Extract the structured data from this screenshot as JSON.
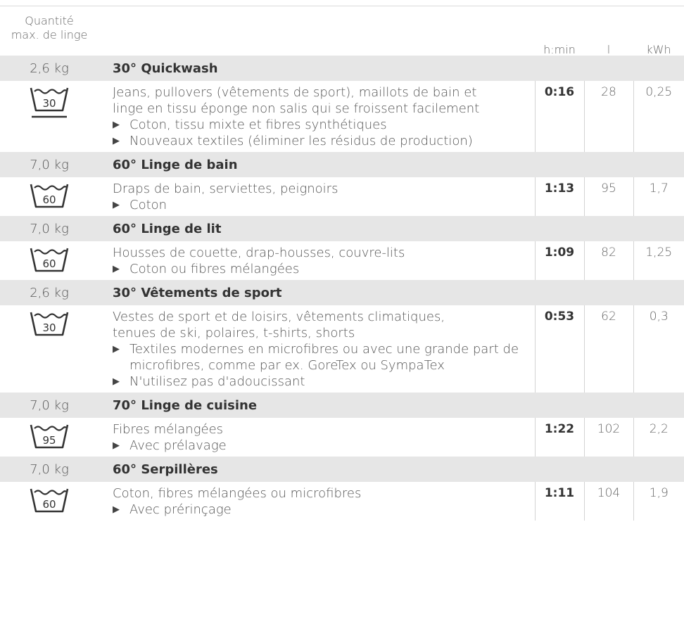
{
  "header": {
    "load_line1": "Quantité",
    "load_line2": "max. de linge",
    "time": "h:min",
    "water": "l",
    "energy": "kWh"
  },
  "programs": [
    {
      "load": "2,6 kg",
      "title": "30° Quickwash",
      "symbol_temp": "30",
      "symbol_underline": true,
      "desc_lines": [
        "Jeans, pullovers (vêtements de sport), maillots de bain et",
        "linge en tissu éponge non salis qui se froissent facilement"
      ],
      "bullets": [
        "Coton, tissu mixte et fibres synthétiques",
        "Nouveaux textiles (éliminer les résidus de production)"
      ],
      "time": "0:16",
      "water": "28",
      "energy": "0,25"
    },
    {
      "load": "7,0 kg",
      "title": "60° Linge de bain",
      "symbol_temp": "60",
      "symbol_underline": false,
      "desc_lines": [
        "Draps de bain, serviettes, peignoirs"
      ],
      "bullets": [
        "Coton"
      ],
      "time": "1:13",
      "water": "95",
      "energy": "1,7"
    },
    {
      "load": "7,0 kg",
      "title": "60° Linge de lit",
      "symbol_temp": "60",
      "symbol_underline": false,
      "desc_lines": [
        "Housses de couette, drap-housses, couvre-lits"
      ],
      "bullets": [
        "Coton ou fibres mélangées"
      ],
      "time": "1:09",
      "water": "82",
      "energy": "1,25"
    },
    {
      "load": "2,6 kg",
      "title": "30° Vêtements de sport",
      "symbol_temp": "30",
      "symbol_underline": false,
      "desc_lines": [
        "Vestes de sport et de loisirs, vêtements climatiques,",
        "tenues de ski, polaires, t-shirts, shorts"
      ],
      "bullets": [
        "Textiles modernes en microfibres ou avec une grande part de microfibres, comme par ex. GoreTex ou SympaTex",
        "N'utilisez pas d'adoucissant"
      ],
      "time": "0:53",
      "water": "62",
      "energy": "0,3"
    },
    {
      "load": "7,0 kg",
      "title": "70° Linge de cuisine",
      "symbol_temp": "95",
      "symbol_underline": false,
      "desc_lines": [
        "Fibres mélangées"
      ],
      "bullets": [
        "Avec prélavage"
      ],
      "time": "1:22",
      "water": "102",
      "energy": "2,2"
    },
    {
      "load": "7,0 kg",
      "title": "60° Serpillères",
      "symbol_temp": "60",
      "symbol_underline": false,
      "desc_lines": [
        "Coton, fibres mélangées ou microfibres"
      ],
      "bullets": [
        "Avec prérinçage"
      ],
      "time": "1:11",
      "water": "104",
      "energy": "1,9"
    }
  ]
}
